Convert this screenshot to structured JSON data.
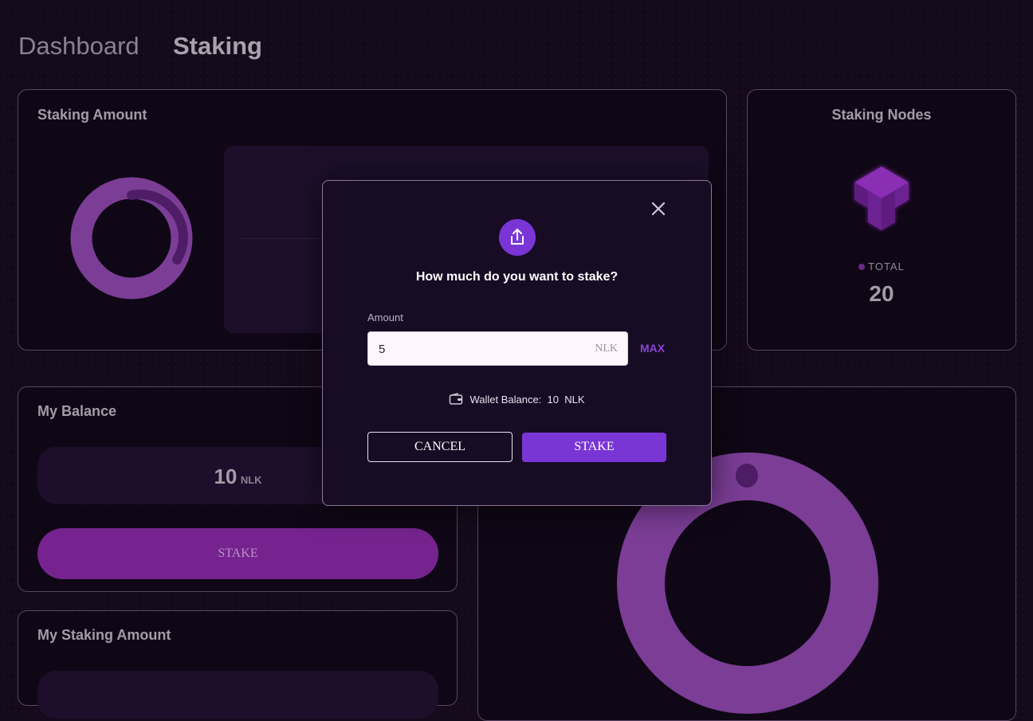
{
  "nav": {
    "tab_dashboard": "Dashboard",
    "tab_staking": "Staking"
  },
  "staking_amount_card": {
    "title": "Staking Amount",
    "ring_progress_pct": 28
  },
  "staking_nodes_card": {
    "title": "Staking Nodes",
    "total_label": "TOTAL",
    "total_value": "20"
  },
  "balance_card": {
    "title": "My Balance",
    "amount": "10",
    "unit": "NLK",
    "stake_label": "STAKE"
  },
  "my_staking_card": {
    "title": "My Staking Amount"
  },
  "modal": {
    "title": "How much do you want to stake?",
    "amount_label": "Amount",
    "amount_value": "5",
    "unit": "NLK",
    "max_label": "MAX",
    "wallet_label": "Wallet Balance:",
    "wallet_amount": "10",
    "wallet_unit": "NLK",
    "cancel_label": "CANCEL",
    "stake_label": "STAKE"
  },
  "colors": {
    "accent": "#7a35d6",
    "ring": "#7b3d96",
    "bg": "#150a1b"
  }
}
